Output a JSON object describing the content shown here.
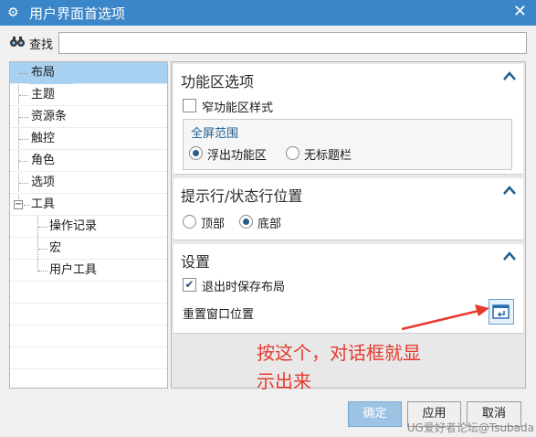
{
  "window": {
    "title": "用户界面首选项",
    "gear_icon": "gear-icon",
    "close_icon": "close-icon"
  },
  "search": {
    "label": "查找",
    "value": "",
    "placeholder": ""
  },
  "tree": {
    "items": [
      {
        "label": "布局",
        "selected": true
      },
      {
        "label": "主题"
      },
      {
        "label": "资源条"
      },
      {
        "label": "触控"
      },
      {
        "label": "角色"
      },
      {
        "label": "选项"
      },
      {
        "label": "工具",
        "expander": "−"
      },
      {
        "label": "操作记录"
      },
      {
        "label": "宏"
      },
      {
        "label": "用户工具"
      }
    ]
  },
  "sections": {
    "ribbon": {
      "title": "功能区选项",
      "toggle": "^",
      "narrow_style_label": "窄功能区样式",
      "narrow_style_checked": false,
      "fullscreen_group_title": "全屏范围",
      "float_ribbon_label": "浮出功能区",
      "no_titlebar_label": "无标题栏",
      "selected": "float_ribbon"
    },
    "statusbar": {
      "title": "提示行/状态行位置",
      "toggle": "^",
      "top_label": "顶部",
      "bottom_label": "底部",
      "selected": "bottom"
    },
    "settings": {
      "title": "设置",
      "toggle": "^",
      "save_layout_label": "退出时保存布局",
      "save_layout_checked": true,
      "reset_window_label": "重置窗口位置"
    }
  },
  "annotation": {
    "line1": "按这个，对话框就显",
    "line2": "示出来",
    "color": "#e53a2e"
  },
  "buttons": {
    "ok": "确定",
    "apply": "应用",
    "cancel": "取消"
  },
  "watermark": "UG爱好者论坛@Tsubada",
  "colors": {
    "titlebar": "#3b86c8",
    "selection": "#a8d0f0",
    "accent": "#1f5f8f"
  }
}
